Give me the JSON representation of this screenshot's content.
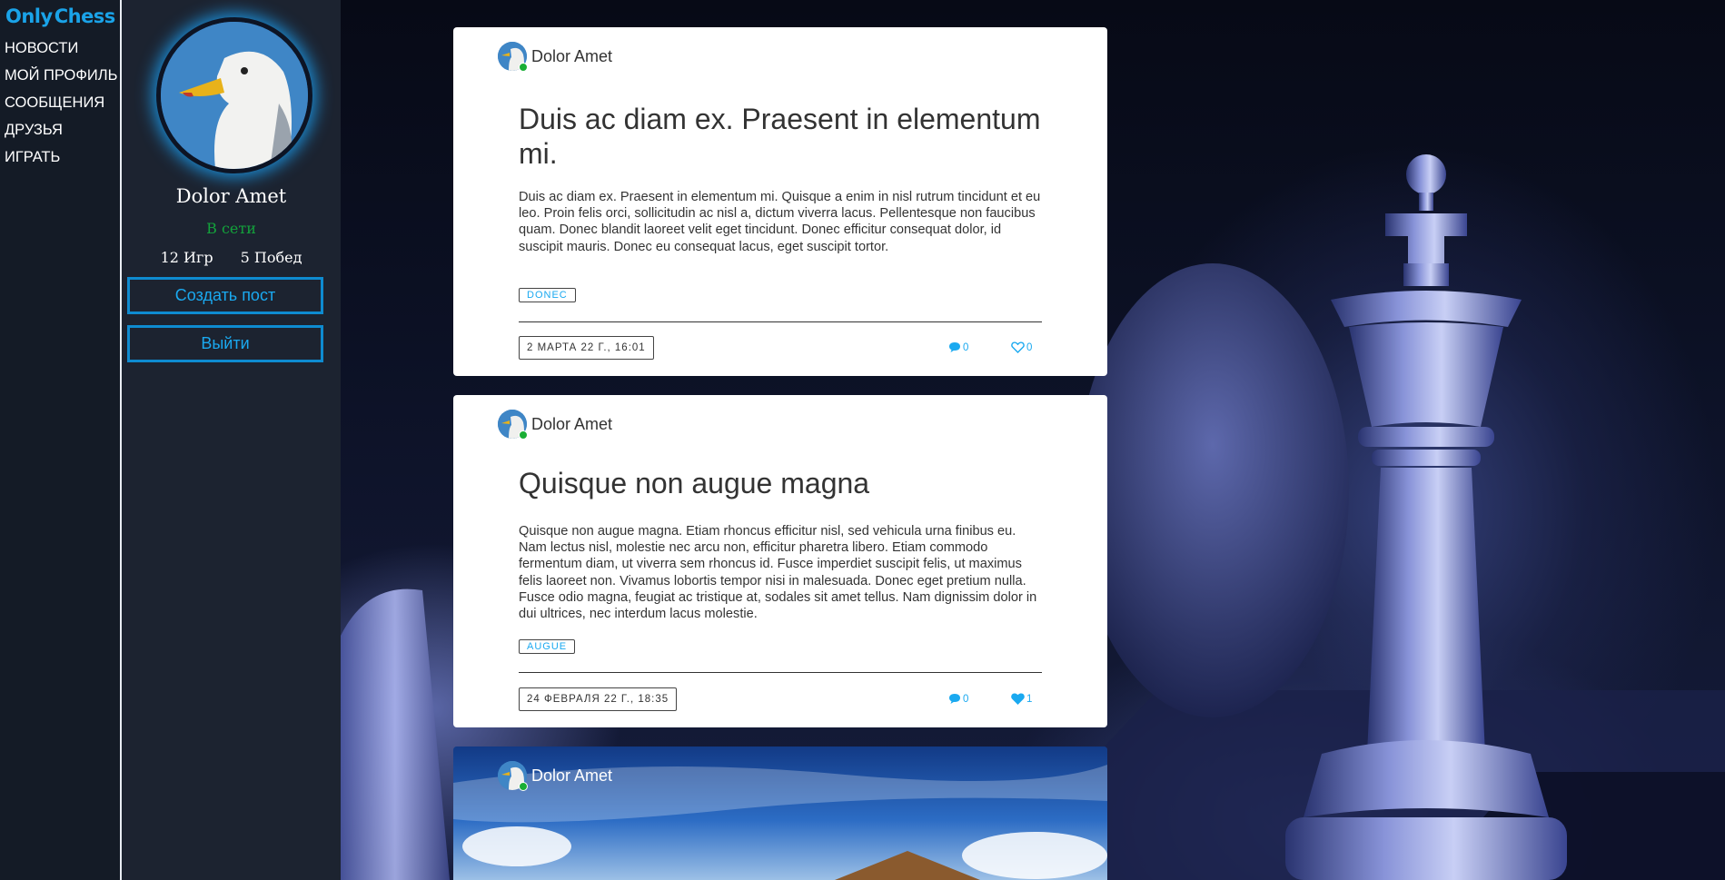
{
  "nav": {
    "logo_left": "Only",
    "logo_right": "Chess",
    "items": [
      "НОВОСТИ",
      "МОЙ ПРОФИЛЬ",
      "СООБЩЕНИЯ",
      "ДРУЗЬЯ",
      "ИГРАТЬ"
    ]
  },
  "profile": {
    "name": "Dolor Amet",
    "status": "В сети",
    "games": "12 Игр",
    "wins": "5 Побед",
    "create_post_label": "Создать пост",
    "logout_label": "Выйти"
  },
  "posts": [
    {
      "author": "Dolor Amet",
      "title": "Duis ac diam ex. Praesent in elementum mi.",
      "body": "Duis ac diam ex. Praesent in elementum mi. Quisque a enim in nisl rutrum tincidunt et eu leo. Proin felis orci, sollicitudin ac nisl a, dictum viverra lacus. Pellentesque non faucibus quam. Donec blandit laoreet velit eget tincidunt. Donec efficitur consequat dolor, id suscipit mauris. Donec eu consequat lacus, eget suscipit tortor.",
      "tag": "DONEC",
      "date": "2 МАРТА 22 Г., 16:01",
      "comments": "0",
      "likes": "0",
      "liked": false
    },
    {
      "author": "Dolor Amet",
      "title": "Quisque non augue magna",
      "body": "Quisque non augue magna. Etiam rhoncus efficitur nisl, sed vehicula urna finibus eu. Nam lectus nisl, molestie nec arcu non, efficitur pharetra libero. Etiam commodo fermentum diam, ut viverra sem rhoncus id. Fusce imperdiet suscipit felis, ut maximus felis laoreet non. Vivamus lobortis tempor nisi in malesuada. Donec eget pretium nulla. Fusce odio magna, feugiat ac tristique at, sodales sit amet tellus. Nam dignissim dolor in dui ultrices, nec interdum lacus molestie.",
      "tag": "AUGUE",
      "date": "24 ФЕВРАЛЯ 22 Г., 18:35",
      "comments": "0",
      "likes": "1",
      "liked": true
    },
    {
      "author": "Dolor Amet"
    }
  ],
  "colors": {
    "accent": "#1aa9f0",
    "online": "#13a23b",
    "nav_bg": "#141b26",
    "profile_bg": "#1c2330"
  },
  "icons": {
    "comment": "comment-icon",
    "like": "heart-icon",
    "logo": "pawn-icon"
  }
}
